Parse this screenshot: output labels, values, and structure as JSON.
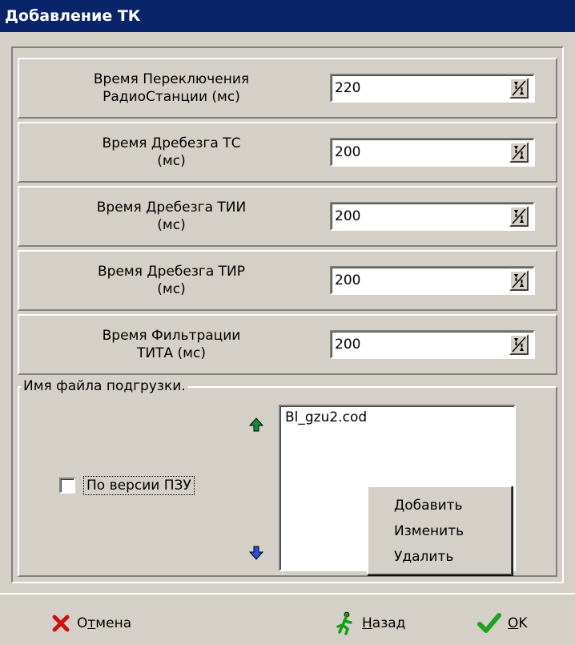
{
  "window": {
    "title": "Добавление ТК"
  },
  "settings": [
    {
      "label": "Время Переключения\nРадиоСтанции (мс)",
      "value": "220"
    },
    {
      "label": "Время Дребезга ТС\n(мс)",
      "value": "200"
    },
    {
      "label": "Время Дребезга ТИИ\n(мс)",
      "value": "200"
    },
    {
      "label": "Время Дребезга ТИР\n(мс)",
      "value": "200"
    },
    {
      "label": "Время Фильтрации\nТИТА (мс)",
      "value": "200"
    }
  ],
  "load_group": {
    "legend": "Имя файла подгрузки.",
    "checkbox_label": "По версии ПЗУ",
    "checked": false,
    "files": [
      "Bl_gzu2.cod"
    ]
  },
  "context_menu": {
    "items": [
      "Добавить",
      "Изменить",
      "Удалить"
    ]
  },
  "buttons": {
    "cancel": {
      "mnemonic": "О",
      "mnemonic_char": "т",
      "rest": "мена"
    },
    "back": {
      "mnemonic": "Н",
      "rest": "азад"
    },
    "ok": {
      "mnemonic": "O",
      "rest": "K"
    }
  },
  "colors": {
    "titlebar": "#0a246a",
    "face": "#d4d0c8",
    "arrow_up": "#1a8a3a",
    "arrow_down": "#2a4fd0",
    "cancel_icon": "#d01010",
    "back_icon": "#10a010",
    "ok_icon": "#20a020"
  }
}
